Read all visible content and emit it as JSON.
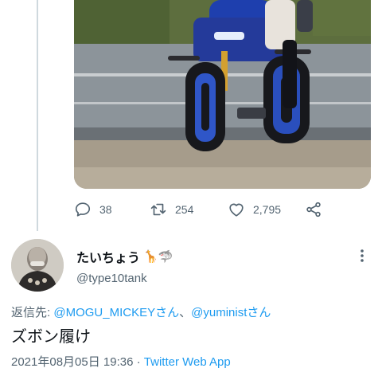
{
  "tweet": {
    "counts": {
      "replies": "38",
      "retweets": "254",
      "likes": "2,795"
    },
    "author": {
      "name": "たいちょう",
      "emoji": "🦒🦈",
      "handle": "@type10tank"
    },
    "replying_prefix": "返信先: ",
    "mentions": [
      "@MOGU_MICKEY",
      "@yuminist"
    ],
    "mention_suffix": "さん",
    "mention_separator": "、",
    "text": "ズボン履け",
    "timestamp": "2021年08月05日 19:36",
    "separator": " · ",
    "source": "Twitter Web App"
  },
  "icons": {
    "reply": "reply-icon",
    "retweet": "retweet-icon",
    "like": "heart-icon",
    "share": "share-icon",
    "more": "more-icon"
  },
  "colors": {
    "accent": "#1d9bf0",
    "muted": "#536471",
    "text": "#0f1419",
    "thread_line": "#cfd9de"
  }
}
